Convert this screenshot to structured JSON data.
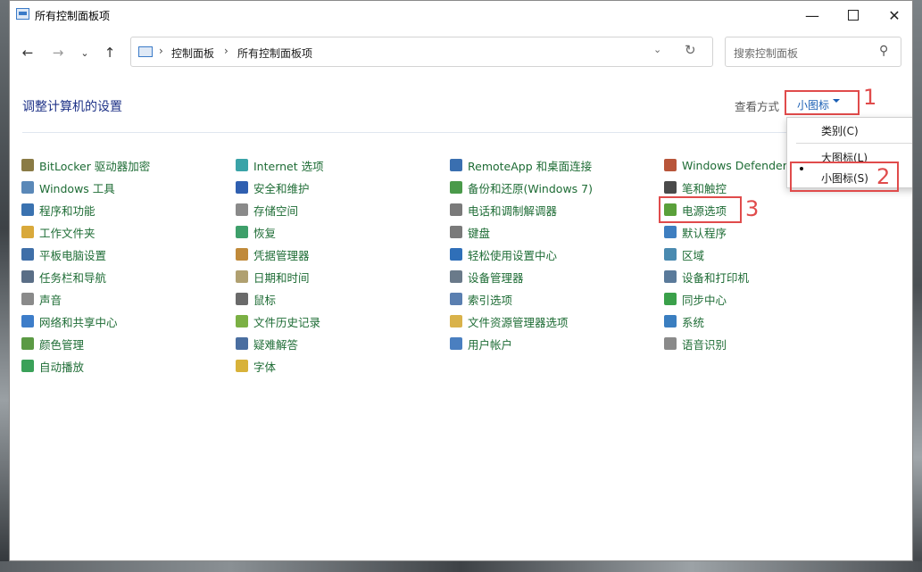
{
  "window": {
    "title": "所有控制面板项"
  },
  "address": {
    "crumbs": [
      "控制面板",
      "所有控制面板项"
    ]
  },
  "search": {
    "placeholder": "搜索控制面板"
  },
  "main": {
    "heading": "调整计算机的设置",
    "view_by_label": "查看方式",
    "view_by_value": "小图标"
  },
  "view_menu": {
    "items": [
      "类别(C)",
      "大图标(L)",
      "小图标(S)"
    ],
    "selected": "小图标(S)"
  },
  "annotations": [
    "1",
    "2",
    "3"
  ],
  "columns": [
    [
      {
        "label": "BitLocker 驱动器加密",
        "icon": "bitlocker-icon",
        "color": "#8a7b45"
      },
      {
        "label": "Windows 工具",
        "icon": "windows-tools-icon",
        "color": "#5a88b8"
      },
      {
        "label": "程序和功能",
        "icon": "programs-icon",
        "color": "#3a72b0"
      },
      {
        "label": "工作文件夹",
        "icon": "work-folders-icon",
        "color": "#d9a93b"
      },
      {
        "label": "平板电脑设置",
        "icon": "tablet-icon",
        "color": "#3f6fa8"
      },
      {
        "label": "任务栏和导航",
        "icon": "taskbar-icon",
        "color": "#5a6e86"
      },
      {
        "label": "声音",
        "icon": "sound-icon",
        "color": "#8a8a8a"
      },
      {
        "label": "网络和共享中心",
        "icon": "network-icon",
        "color": "#3d7dc9"
      },
      {
        "label": "颜色管理",
        "icon": "color-mgmt-icon",
        "color": "#5b9a44"
      },
      {
        "label": "自动播放",
        "icon": "autoplay-icon",
        "color": "#3aa159"
      }
    ],
    [
      {
        "label": "Internet 选项",
        "icon": "internet-icon",
        "color": "#3aa3a8"
      },
      {
        "label": "安全和维护",
        "icon": "security-flag-icon",
        "color": "#2f5fb0"
      },
      {
        "label": "存储空间",
        "icon": "storage-icon",
        "color": "#8a8a8a"
      },
      {
        "label": "恢复",
        "icon": "recovery-icon",
        "color": "#3e9f6a"
      },
      {
        "label": "凭据管理器",
        "icon": "credential-icon",
        "color": "#c08a3a"
      },
      {
        "label": "日期和时间",
        "icon": "datetime-icon",
        "color": "#b0a070"
      },
      {
        "label": "鼠标",
        "icon": "mouse-icon",
        "color": "#6a6a6a"
      },
      {
        "label": "文件历史记录",
        "icon": "file-history-icon",
        "color": "#7bb044"
      },
      {
        "label": "疑难解答",
        "icon": "troubleshoot-icon",
        "color": "#4a6ea0"
      },
      {
        "label": "字体",
        "icon": "fonts-icon",
        "color": "#d8b23a"
      }
    ],
    [
      {
        "label": "RemoteApp 和桌面连接",
        "icon": "remoteapp-icon",
        "color": "#3a6fb0"
      },
      {
        "label": "备份和还原(Windows 7)",
        "icon": "backup-icon",
        "color": "#4a9a4a"
      },
      {
        "label": "电话和调制解调器",
        "icon": "phone-icon",
        "color": "#7a7a7a"
      },
      {
        "label": "键盘",
        "icon": "keyboard-icon",
        "color": "#7a7a7a"
      },
      {
        "label": "轻松使用设置中心",
        "icon": "ease-of-access-icon",
        "color": "#2f6fb8"
      },
      {
        "label": "设备管理器",
        "icon": "device-manager-icon",
        "color": "#6a7a8a"
      },
      {
        "label": "索引选项",
        "icon": "indexing-icon",
        "color": "#5a7fb0"
      },
      {
        "label": "文件资源管理器选项",
        "icon": "folder-options-icon",
        "color": "#d9b24a"
      },
      {
        "label": "用户帐户",
        "icon": "user-accounts-icon",
        "color": "#4a7fc0"
      }
    ],
    [
      {
        "label": "Windows Defender",
        "icon": "defender-firewall-icon",
        "color": "#b8553a"
      },
      {
        "label": "笔和触控",
        "icon": "pen-touch-icon",
        "color": "#4a4a4a"
      },
      {
        "label": "电源选项",
        "icon": "power-options-icon",
        "color": "#5aa03a"
      },
      {
        "label": "默认程序",
        "icon": "default-programs-icon",
        "color": "#3e7ec0"
      },
      {
        "label": "区域",
        "icon": "region-icon",
        "color": "#4a8ab0"
      },
      {
        "label": "设备和打印机",
        "icon": "devices-printers-icon",
        "color": "#5a7a9a"
      },
      {
        "label": "同步中心",
        "icon": "sync-center-icon",
        "color": "#3aa04a"
      },
      {
        "label": "系统",
        "icon": "system-icon",
        "color": "#3a7ec0"
      },
      {
        "label": "语音识别",
        "icon": "speech-icon",
        "color": "#8a8a8a"
      }
    ]
  ]
}
